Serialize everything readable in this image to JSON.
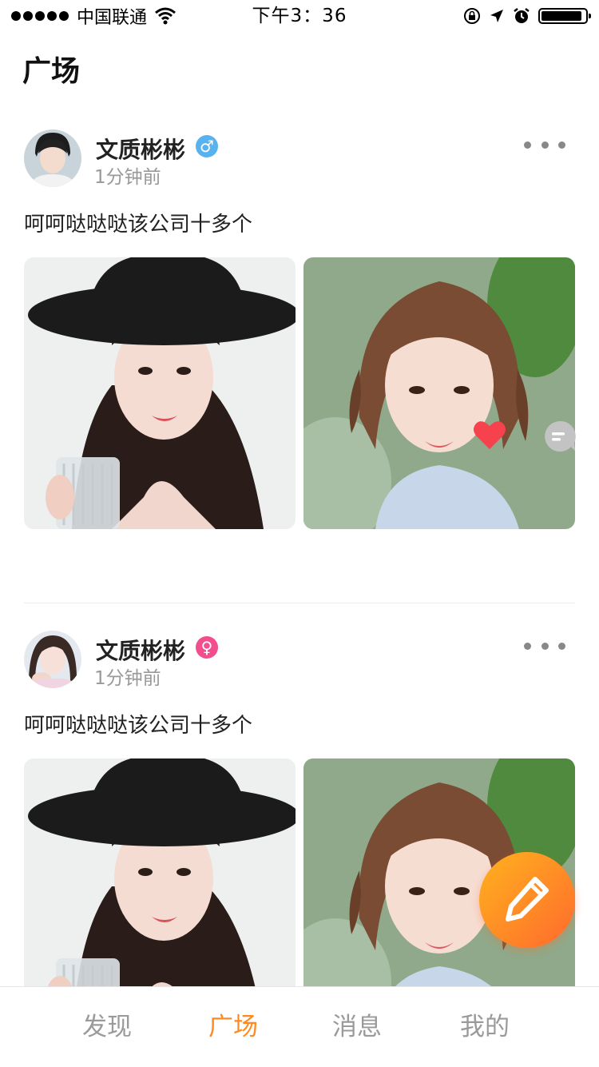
{
  "status_bar": {
    "carrier": "中国联通",
    "time": "下午3：36",
    "icons": [
      "signal-dots-icon",
      "wifi-icon",
      "rotation-lock-icon",
      "location-arrow-icon",
      "alarm-icon",
      "battery-icon"
    ]
  },
  "page_title": "广场",
  "posts": [
    {
      "user_name": "文质彬彬",
      "gender_symbol": "♂",
      "time": "1分钟前",
      "text": "呵呵哒哒哒该公司十多个"
    },
    {
      "user_name": "文质彬彬",
      "gender_symbol": "♀",
      "time": "1分钟前",
      "text": "呵呵哒哒哒该公司十多个"
    }
  ],
  "tabs": [
    {
      "label": "发现",
      "active": false
    },
    {
      "label": "广场",
      "active": true
    },
    {
      "label": "消息",
      "active": false
    },
    {
      "label": "我的",
      "active": false
    }
  ],
  "colors": {
    "accent": "#ff8a1f",
    "male_badge": "#58b2ee",
    "female_badge": "#f24e8e",
    "like": "#f5424d",
    "inactive_tab": "#9a9a9a"
  }
}
